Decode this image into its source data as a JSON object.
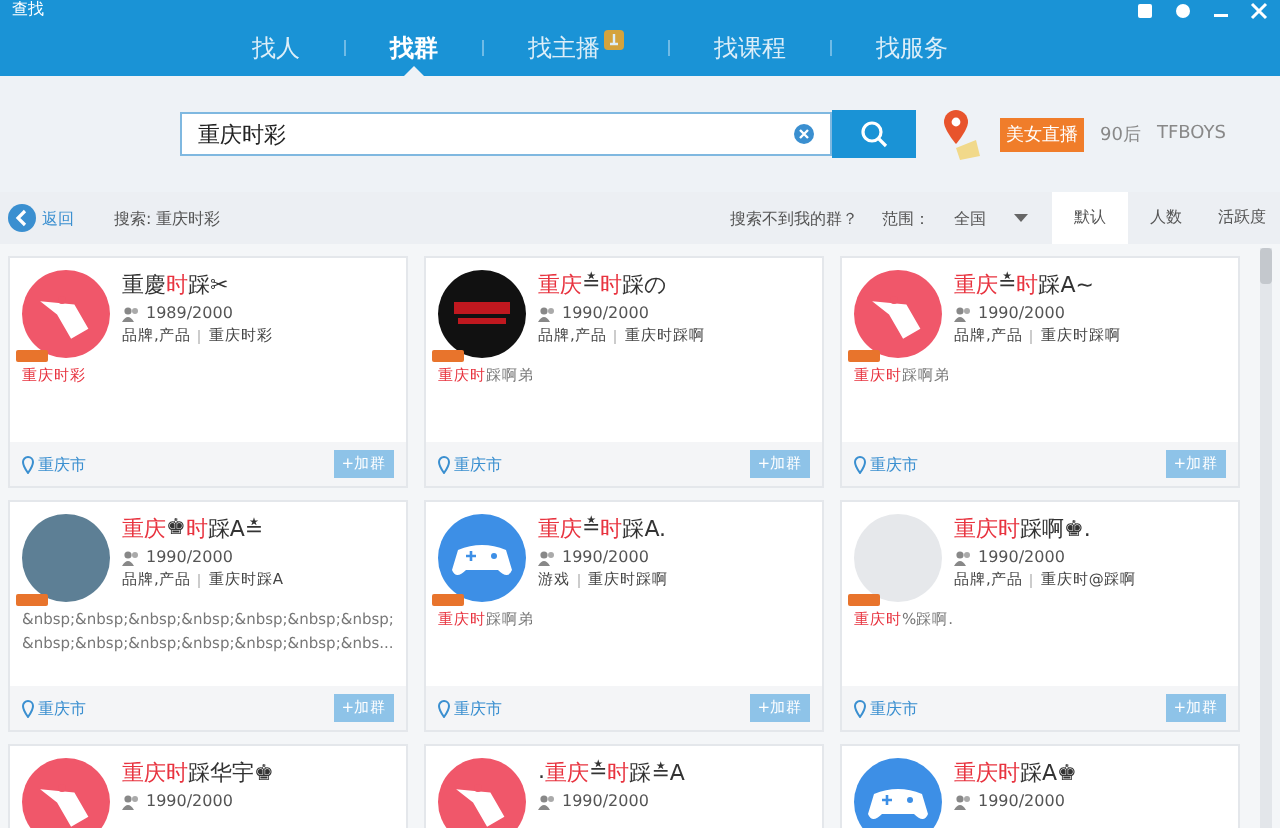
{
  "window": {
    "title": "查找"
  },
  "nav_tabs": [
    {
      "label": "找人",
      "selected": false,
      "hot": false
    },
    {
      "label": "找群",
      "selected": true,
      "hot": false
    },
    {
      "label": "找主播",
      "selected": false,
      "hot": true
    },
    {
      "label": "找课程",
      "selected": false,
      "hot": false
    },
    {
      "label": "找服务",
      "selected": false,
      "hot": false
    }
  ],
  "search": {
    "value": "重庆时彩",
    "hot_tags": [
      "美女直播",
      "90后",
      "TFBOYS"
    ]
  },
  "toolbar": {
    "back": "返回",
    "query": "搜索: 重庆时彩",
    "hint": "搜索不到我的群？",
    "range_label": "范围：",
    "range_value": "全国",
    "sort_tabs": [
      {
        "label": "默认",
        "selected": true
      },
      {
        "label": "人数",
        "selected": false
      },
      {
        "label": "活跃度",
        "selected": false
      }
    ]
  },
  "cards": [
    {
      "kind": "tag",
      "name": [
        {
          "t": "重慶",
          "hl": false
        },
        {
          "t": "时",
          "hl": true
        },
        {
          "t": "踩✂",
          "hl": false
        }
      ],
      "members": "1989/2000",
      "category": "品牌,产品",
      "keyword": "重庆时彩",
      "desc": [
        {
          "t": "重庆时彩",
          "hl": true
        }
      ],
      "location": "重庆市",
      "join": "+加群"
    },
    {
      "kind": "dark",
      "name": [
        {
          "t": "重庆",
          "hl": true
        },
        {
          "t": "≛",
          "hl": false
        },
        {
          "t": "时",
          "hl": true
        },
        {
          "t": "踩の",
          "hl": false
        }
      ],
      "members": "1990/2000",
      "category": "品牌,产品",
      "keyword": "重庆时踩啊",
      "desc": [
        {
          "t": "重庆时",
          "hl": true
        },
        {
          "t": "踩啊弟",
          "hl": false
        }
      ],
      "location": "重庆市",
      "join": "+加群"
    },
    {
      "kind": "tag",
      "name": [
        {
          "t": "重庆",
          "hl": true
        },
        {
          "t": "≛",
          "hl": false
        },
        {
          "t": "时",
          "hl": true
        },
        {
          "t": "踩A~",
          "hl": false
        }
      ],
      "members": "1990/2000",
      "category": "品牌,产品",
      "keyword": "重庆时踩啊",
      "desc": [
        {
          "t": "重庆时",
          "hl": true
        },
        {
          "t": "踩啊弟",
          "hl": false
        }
      ],
      "location": "重庆市",
      "join": "+加群"
    },
    {
      "kind": "photo",
      "name": [
        {
          "t": "重庆",
          "hl": true
        },
        {
          "t": "♚",
          "hl": false
        },
        {
          "t": "时",
          "hl": true
        },
        {
          "t": "踩A≛",
          "hl": false
        }
      ],
      "members": "1990/2000",
      "category": "品牌,产品",
      "keyword": "重庆时踩A",
      "desc": [
        {
          "t": "&nbsp;&nbsp;&nbsp;&nbsp;&nbsp;&nbsp;&nbsp;&nbsp;&nbsp;&nbsp;&nbsp;&nbsp;&nbsp;&nbs...",
          "hl": false
        }
      ],
      "location": "重庆市",
      "join": "+加群"
    },
    {
      "kind": "gamepad",
      "name": [
        {
          "t": "重庆",
          "hl": true
        },
        {
          "t": "≛",
          "hl": false
        },
        {
          "t": "时",
          "hl": true
        },
        {
          "t": "踩A.",
          "hl": false
        }
      ],
      "members": "1990/2000",
      "category": "游戏",
      "keyword": "重庆时踩啊",
      "desc": [
        {
          "t": "重庆时",
          "hl": true
        },
        {
          "t": "踩啊弟",
          "hl": false
        }
      ],
      "location": "重庆市",
      "join": "+加群"
    },
    {
      "kind": "blank",
      "name": [
        {
          "t": "重庆时",
          "hl": true
        },
        {
          "t": "踩啊♚.",
          "hl": false
        }
      ],
      "members": "1990/2000",
      "category": "品牌,产品",
      "keyword": "重庆时@踩啊",
      "desc": [
        {
          "t": "重庆时",
          "hl": true
        },
        {
          "t": "%踩啊.",
          "hl": false
        }
      ],
      "location": "重庆市",
      "join": "+加群"
    },
    {
      "kind": "tag",
      "name": [
        {
          "t": "重庆时",
          "hl": true
        },
        {
          "t": "踩华宇♚",
          "hl": false
        }
      ],
      "members": "1990/2000"
    },
    {
      "kind": "tag",
      "name": [
        {
          "t": ".",
          "hl": false
        },
        {
          "t": "重庆",
          "hl": true
        },
        {
          "t": "≛",
          "hl": false
        },
        {
          "t": "时",
          "hl": true
        },
        {
          "t": "踩≛A",
          "hl": false
        }
      ],
      "members": "1990/2000"
    },
    {
      "kind": "gamepad",
      "name": [
        {
          "t": "重庆时",
          "hl": true
        },
        {
          "t": "踩A♚",
          "hl": false
        }
      ],
      "members": "1990/2000"
    }
  ]
}
